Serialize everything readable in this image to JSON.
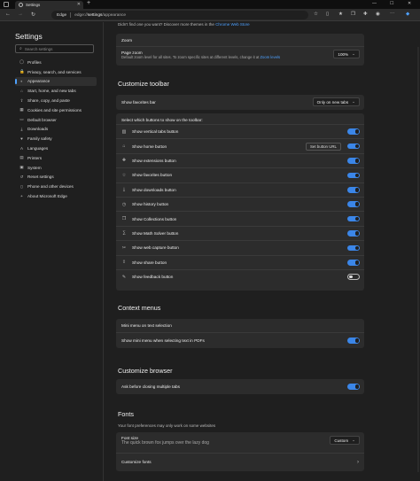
{
  "window": {
    "tab_title": "Settings",
    "new_tab_glyph": "+",
    "minimize": "—",
    "maximize": "☐",
    "close": "✕"
  },
  "address": {
    "brand": "Edge",
    "url_prefix": "edge://",
    "url_bold": "settings",
    "url_suffix": "/appearance"
  },
  "sidebar": {
    "title": "Settings",
    "search_placeholder": "Search settings",
    "items": [
      {
        "label": "Profiles",
        "icon": "profile-icon"
      },
      {
        "label": "Privacy, search, and services",
        "icon": "lock-icon"
      },
      {
        "label": "Appearance",
        "icon": "appearance-icon",
        "active": true
      },
      {
        "label": "Start, home, and new tabs",
        "icon": "home-icon"
      },
      {
        "label": "Share, copy, and paste",
        "icon": "share-icon"
      },
      {
        "label": "Cookies and site permissions",
        "icon": "cookie-icon"
      },
      {
        "label": "Default browser",
        "icon": "browser-icon"
      },
      {
        "label": "Downloads",
        "icon": "download-icon"
      },
      {
        "label": "Family safety",
        "icon": "family-icon"
      },
      {
        "label": "Languages",
        "icon": "language-icon"
      },
      {
        "label": "Printers",
        "icon": "printer-icon"
      },
      {
        "label": "System",
        "icon": "system-icon"
      },
      {
        "label": "Reset settings",
        "icon": "reset-icon"
      },
      {
        "label": "Phone and other devices",
        "icon": "phone-icon"
      },
      {
        "label": "About Microsoft Edge",
        "icon": "edge-icon"
      }
    ]
  },
  "main": {
    "theme_note": "Didn't find one you want? Discover more themes in the",
    "theme_link": "Chrome Web Store",
    "zoom": {
      "head": "Zoom",
      "label": "Page zoom",
      "desc": "Default zoom level for all sites. To zoom specific sites at different levels, change it at",
      "desc_link": "Zoom levels",
      "value": "100%"
    },
    "toolbar_section": {
      "title": "Customize toolbar",
      "favorites_bar_label": "Show favorites bar",
      "favorites_bar_value": "Only on new tabs",
      "buttons_head": "Select which buttons to show on the toolbar:",
      "set_button_url": "Set button URL",
      "rows": [
        {
          "label": "Show vertical tabs button",
          "icon": "vertical-tabs-icon",
          "on": true
        },
        {
          "label": "Show home button",
          "icon": "home-icon",
          "on": true
        },
        {
          "label": "Show extensions button",
          "icon": "extensions-icon",
          "on": true
        },
        {
          "label": "Show favorites button",
          "icon": "star-icon",
          "on": true
        },
        {
          "label": "Show downloads button",
          "icon": "download-icon",
          "on": true
        },
        {
          "label": "Show history button",
          "icon": "history-icon",
          "on": true
        },
        {
          "label": "Show Collections button",
          "icon": "collections-icon",
          "on": true
        },
        {
          "label": "Show Math Solver button",
          "icon": "math-icon",
          "on": true
        },
        {
          "label": "Show web capture button",
          "icon": "capture-icon",
          "on": true
        },
        {
          "label": "Show share button",
          "icon": "share-icon",
          "on": true
        },
        {
          "label": "Show feedback button",
          "icon": "feedback-icon",
          "on": false
        }
      ]
    },
    "context_menus": {
      "title": "Context menus",
      "head": "Mini menu on text selection",
      "row": "Show mini menu when selecting text in PDFs"
    },
    "customize_browser": {
      "title": "Customize browser",
      "row": "Ask before closing multiple tabs"
    },
    "fonts": {
      "title": "Fonts",
      "note": "Your font preferences may only work on some websites",
      "size_label": "Font size",
      "size_value": "Custom",
      "sample": "The quick brown fox jumps over the lazy dog",
      "customize": "Customize fonts"
    }
  },
  "colors": {
    "accent": "#3b86e8",
    "background": "#1f1f1f",
    "card": "#2c2c2c"
  }
}
